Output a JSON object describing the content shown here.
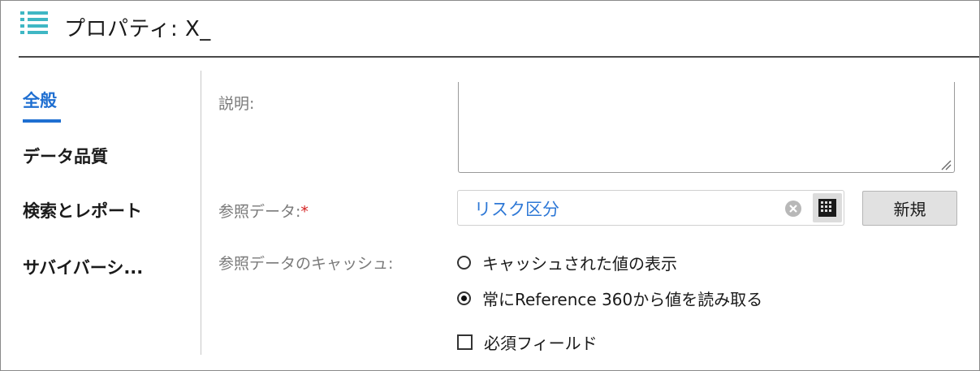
{
  "header": {
    "icon": "list-icon",
    "title": "プロパティ: X_"
  },
  "sidebar": {
    "items": [
      {
        "label": "全般",
        "active": true
      },
      {
        "label": "データ品質",
        "active": false
      },
      {
        "label": "検索とレポート",
        "active": false
      },
      {
        "label": "サバイバーシ...",
        "active": false
      }
    ]
  },
  "form": {
    "description_label": "説明:",
    "description_value": "",
    "reference_label": "参照データ:",
    "required_mark": "*",
    "reference_value": "リスク区分",
    "new_button": "新規",
    "cache_label": "参照データのキャッシュ:",
    "cache_options": [
      {
        "label": "キャッシュされた値の表示",
        "selected": false
      },
      {
        "label": "常にReference 360から値を読み取る",
        "selected": true
      }
    ],
    "required_field_label": "必須フィールド",
    "required_field_checked": false
  },
  "colors": {
    "accent": "#1f6fd1",
    "link": "#2e78d6",
    "required": "#d42020",
    "icon_teal": "#3fb7c4"
  }
}
